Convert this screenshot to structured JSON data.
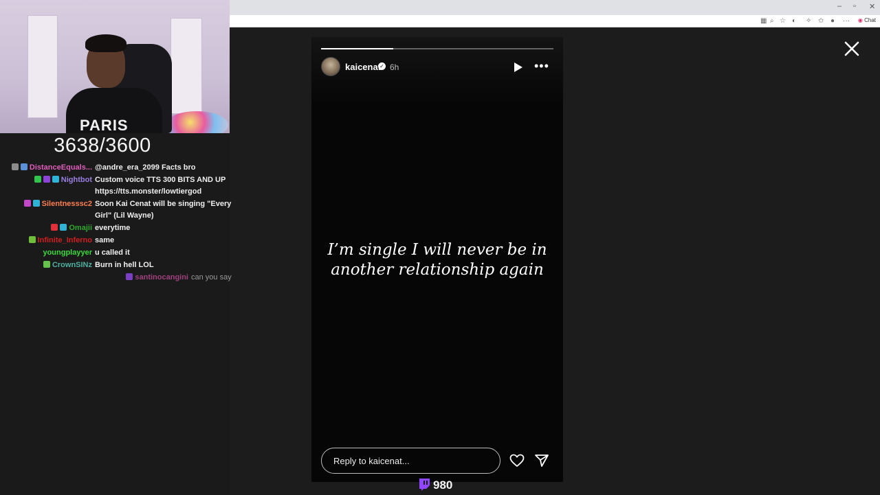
{
  "browser": {
    "window_controls": [
      "–",
      "▫",
      "✕"
    ],
    "chat_extension_label": "Chat"
  },
  "stream": {
    "sub_counter": "3638/3600",
    "bits_count": "980"
  },
  "chat": [
    {
      "name": "DistanceEquals...",
      "color": "#e05dbb",
      "badges": [
        "#8c8c8c",
        "#5b8fd6"
      ],
      "message": "@andre_era_2099 Facts bro"
    },
    {
      "name": "Nightbot",
      "color": "#9a7fe0",
      "badges": [
        "#33c24e",
        "#8c44d8",
        "#2fb4d8"
      ],
      "message": "Custom voice TTS 300 BITS AND UP https://tts.monster/lowtiergod"
    },
    {
      "name": "Silentnesssc2",
      "color": "#ff7f50",
      "badges": [
        "#c546c9",
        "#2fb4d8"
      ],
      "message": "Soon Kai Cenat will be singing \"Every Girl\" (Lil Wayne)"
    },
    {
      "name": "Omajii",
      "color": "#2ea82e",
      "badges": [
        "#e0303a",
        "#2fb4d8"
      ],
      "message": "everytime"
    },
    {
      "name": "Infinite_Inferno",
      "color": "#d11f1f",
      "badges": [
        "#6fbf3a"
      ],
      "message": "same"
    },
    {
      "name": "youngplayyer",
      "color": "#3bd93b",
      "badges": [],
      "message": "u called it"
    },
    {
      "name": "CrownSINz",
      "color": "#4fb0a0",
      "badges": [
        "#66c24a"
      ],
      "message": "Burn in hell LOL"
    },
    {
      "name": "santinocangini",
      "color": "#a0407f",
      "badges": [
        "#7b3fc4"
      ],
      "message": "can you say"
    }
  ],
  "story": {
    "username": "kaicenat",
    "time_ago": "6h",
    "progress": 0.31,
    "text": "I’m single I will never be in another relationship again",
    "reply_placeholder": "Reply to kaicenat...",
    "verified_mark": "✓",
    "more_label": "•••"
  },
  "icons": {
    "play": "play-icon",
    "more": "more-icon",
    "heart": "heart-icon",
    "share": "share-icon",
    "close": "close-icon",
    "bits": "twitch-bits-icon",
    "verified": "verified-icon"
  },
  "colors": {
    "accent_twitch": "#9146ff"
  }
}
